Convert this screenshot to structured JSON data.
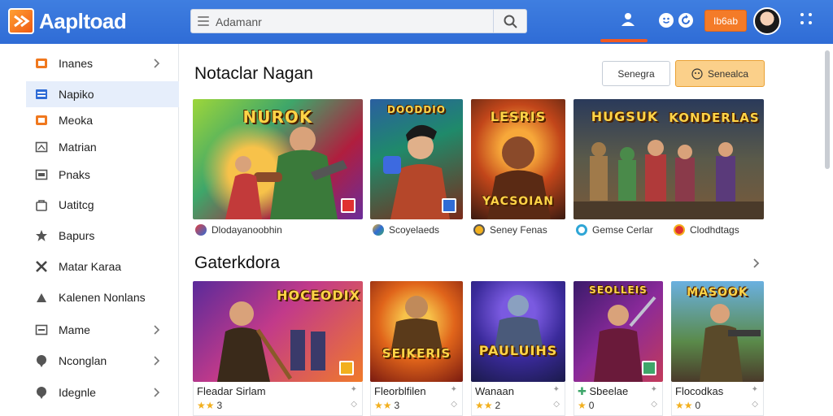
{
  "header": {
    "app_title": "Aapltoad",
    "search_value": "Adamanr",
    "badge_label": "Ib6ab",
    "colors": {
      "bar": "#2f6cd6",
      "accent": "#f15a22"
    }
  },
  "sidebar": {
    "items": [
      {
        "label": "Inanes",
        "icon": "gift-icon",
        "chevron": true
      },
      {
        "label": "Napiko",
        "icon": "window-icon",
        "chevron": false,
        "active": true
      },
      {
        "label": "Meoka",
        "icon": "window-icon",
        "chevron": false
      },
      {
        "label": "Matrian",
        "icon": "window-icon",
        "chevron": false
      },
      {
        "label": "Pnaks",
        "icon": "image-icon",
        "chevron": false
      },
      {
        "label": "Uatitcg",
        "icon": "bag-icon",
        "chevron": false
      },
      {
        "label": "Bapurs",
        "icon": "puzzle-icon",
        "chevron": false
      },
      {
        "label": "Matar Karaa",
        "icon": "cross-icon",
        "chevron": false
      },
      {
        "label": "Kalenen Nonlans",
        "icon": "hand-icon",
        "chevron": false
      },
      {
        "label": "Mame",
        "icon": "window-icon",
        "chevron": true
      },
      {
        "label": "Nconglan",
        "icon": "pin-icon",
        "chevron": true
      },
      {
        "label": "Idegnle",
        "icon": "pin-icon",
        "chevron": true
      }
    ]
  },
  "section1": {
    "title": "Notaclar Nagan",
    "btn_outline": "Senegra",
    "btn_primary": "Senealca",
    "cards": [
      {
        "art_title": "NUROK",
        "caption": "Dlodayanoobhin"
      },
      {
        "art_title": "DOODDIO",
        "caption": "Scoyelaeds"
      },
      {
        "art_title": "LESRIS",
        "art_title2": "YACSOIAN",
        "caption": "Seney Fenas"
      },
      {
        "art_title": "HUGSUK",
        "art_title2": "KONDERLAS",
        "caption": "Gemse Cerlar"
      },
      {
        "caption": "Clodhdtags"
      }
    ]
  },
  "section2": {
    "title": "Gaterkdora",
    "cards": [
      {
        "art_title": "HOCEODIX",
        "name": "Fleadar Sirlam",
        "stars": "★★",
        "num": "3"
      },
      {
        "art_title": "SEIKERIS",
        "name": "Fleorblfilen",
        "stars": "★★",
        "num": "3"
      },
      {
        "art_title": "PAULUIHS",
        "name": "Wanaan",
        "stars": "★★",
        "num": "2"
      },
      {
        "art_title": "SEOLLEIS",
        "name": "Sbeelae",
        "stars": "★",
        "num": "0"
      },
      {
        "art_title": "MASOOK",
        "name": "Flocodkas",
        "stars": "★★",
        "num": "0"
      }
    ]
  }
}
